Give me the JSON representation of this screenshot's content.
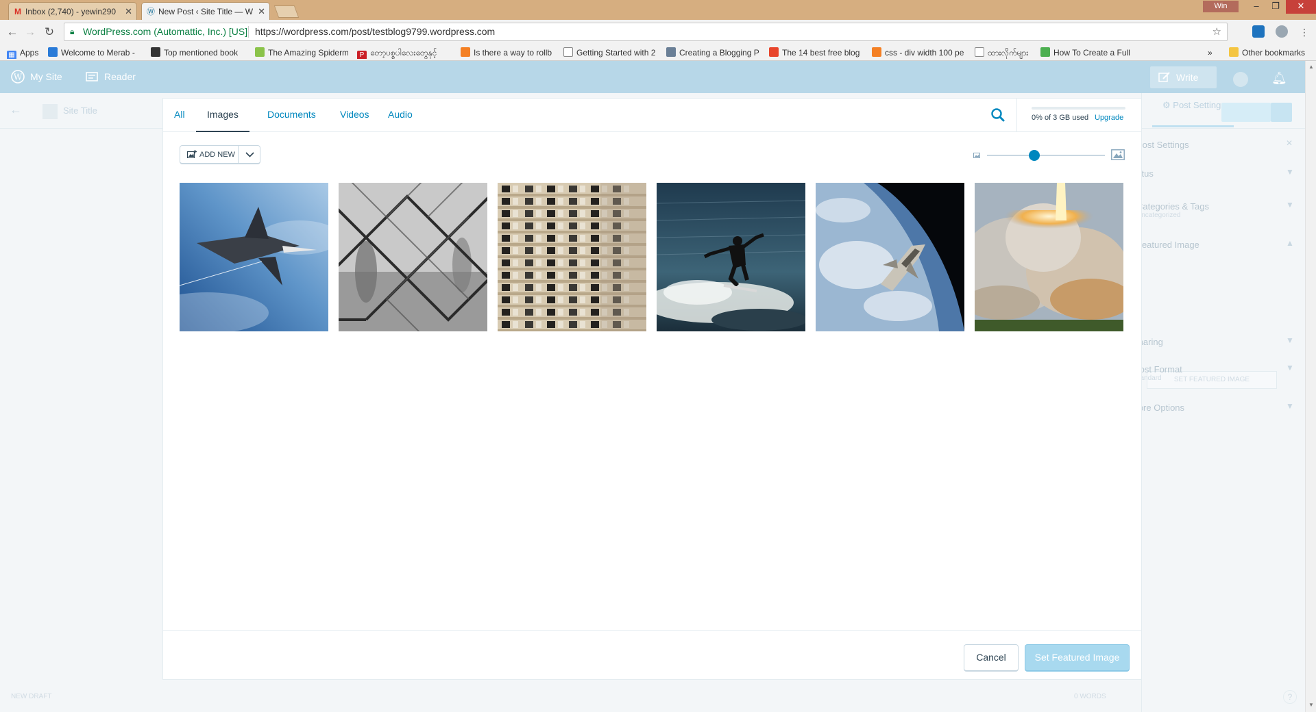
{
  "browser": {
    "tabs": [
      {
        "title": "Inbox (2,740) - yewin290",
        "icon": "gmail-icon",
        "active": false
      },
      {
        "title": "New Post ‹ Site Title — W",
        "icon": "wordpress-icon",
        "active": true
      }
    ],
    "user_badge": "Win",
    "address": {
      "site_identity": "WordPress.com (Automattic, Inc.) [US]",
      "url": "https://wordpress.com/post/testblog9799.wordpress.com"
    },
    "bookmarks": [
      {
        "label": "Apps",
        "icon": "apps-grid-icon",
        "color": "#4285f4"
      },
      {
        "label": "Welcome to Merab -",
        "icon": "merab-icon",
        "color": "#2a7bd8"
      },
      {
        "label": "Top mentioned book",
        "icon": "bar-chart-icon",
        "color": "#333333"
      },
      {
        "label": "The Amazing Spiderm",
        "icon": "document-icon",
        "color": "#8bc34a"
      },
      {
        "label": "တော့ပစ္စပါလေးတွေနှင့်",
        "icon": "pinterest-icon",
        "color": "#cb2027"
      },
      {
        "label": "Is there a way to rollb",
        "icon": "stackoverflow-icon",
        "color": "#f48024"
      },
      {
        "label": "Getting Started with 2",
        "icon": "page-icon",
        "color": "#888888"
      },
      {
        "label": "Creating a Blogging P",
        "icon": "blog-icon",
        "color": "#6a7f96"
      },
      {
        "label": "The 14 best free blog",
        "icon": "brand-icon",
        "color": "#e8452c"
      },
      {
        "label": "css - div width 100 pe",
        "icon": "stackoverflow-icon",
        "color": "#f48024"
      },
      {
        "label": "ထားလိုက်များ",
        "icon": "page-icon",
        "color": "#888888"
      },
      {
        "label": "How To Create a Full",
        "icon": "how-to-icon",
        "color": "#4caf50"
      }
    ],
    "other_bookmarks": "Other bookmarks"
  },
  "masterbar": {
    "my_site": "My Site",
    "reader": "Reader",
    "write": "Write"
  },
  "editor": {
    "site_title": "Site Title",
    "sidebar_tab": "Post Settings",
    "sidebar_rows": [
      {
        "label": "Post Settings",
        "sub": ""
      },
      {
        "label": "Status",
        "sub": ""
      },
      {
        "label": "Categories & Tags",
        "sub": "Uncategorized"
      },
      {
        "label": "Featured Image",
        "sub": ""
      },
      {
        "label": "Sharing",
        "sub": ""
      },
      {
        "label": "Post Format",
        "sub": "Standard"
      },
      {
        "label": "More Options",
        "sub": ""
      }
    ],
    "set_featured_small": "SET FEATURED IMAGE",
    "status_left": "NEW DRAFT",
    "status_right": "0 WORDS"
  },
  "media_modal": {
    "filters": [
      "All",
      "Images",
      "Documents",
      "Videos",
      "Audio"
    ],
    "selected_filter": "Images",
    "storage": {
      "used_text": "0% of 3 GB used",
      "upgrade": "Upgrade",
      "used_fraction": 0.0
    },
    "add_new": "ADD NEW",
    "zoom_level": 0.4,
    "images": [
      {
        "name": "space-shuttle-sky"
      },
      {
        "name": "chain-link-fence"
      },
      {
        "name": "apartment-building"
      },
      {
        "name": "surfer-wave"
      },
      {
        "name": "shuttle-over-earth"
      },
      {
        "name": "rocket-launch"
      }
    ],
    "cancel": "Cancel",
    "set_featured": "Set Featured Image"
  },
  "colors": {
    "accent": "#0087be",
    "masterbar": "#b7d7e8",
    "text": "#2e4453"
  }
}
